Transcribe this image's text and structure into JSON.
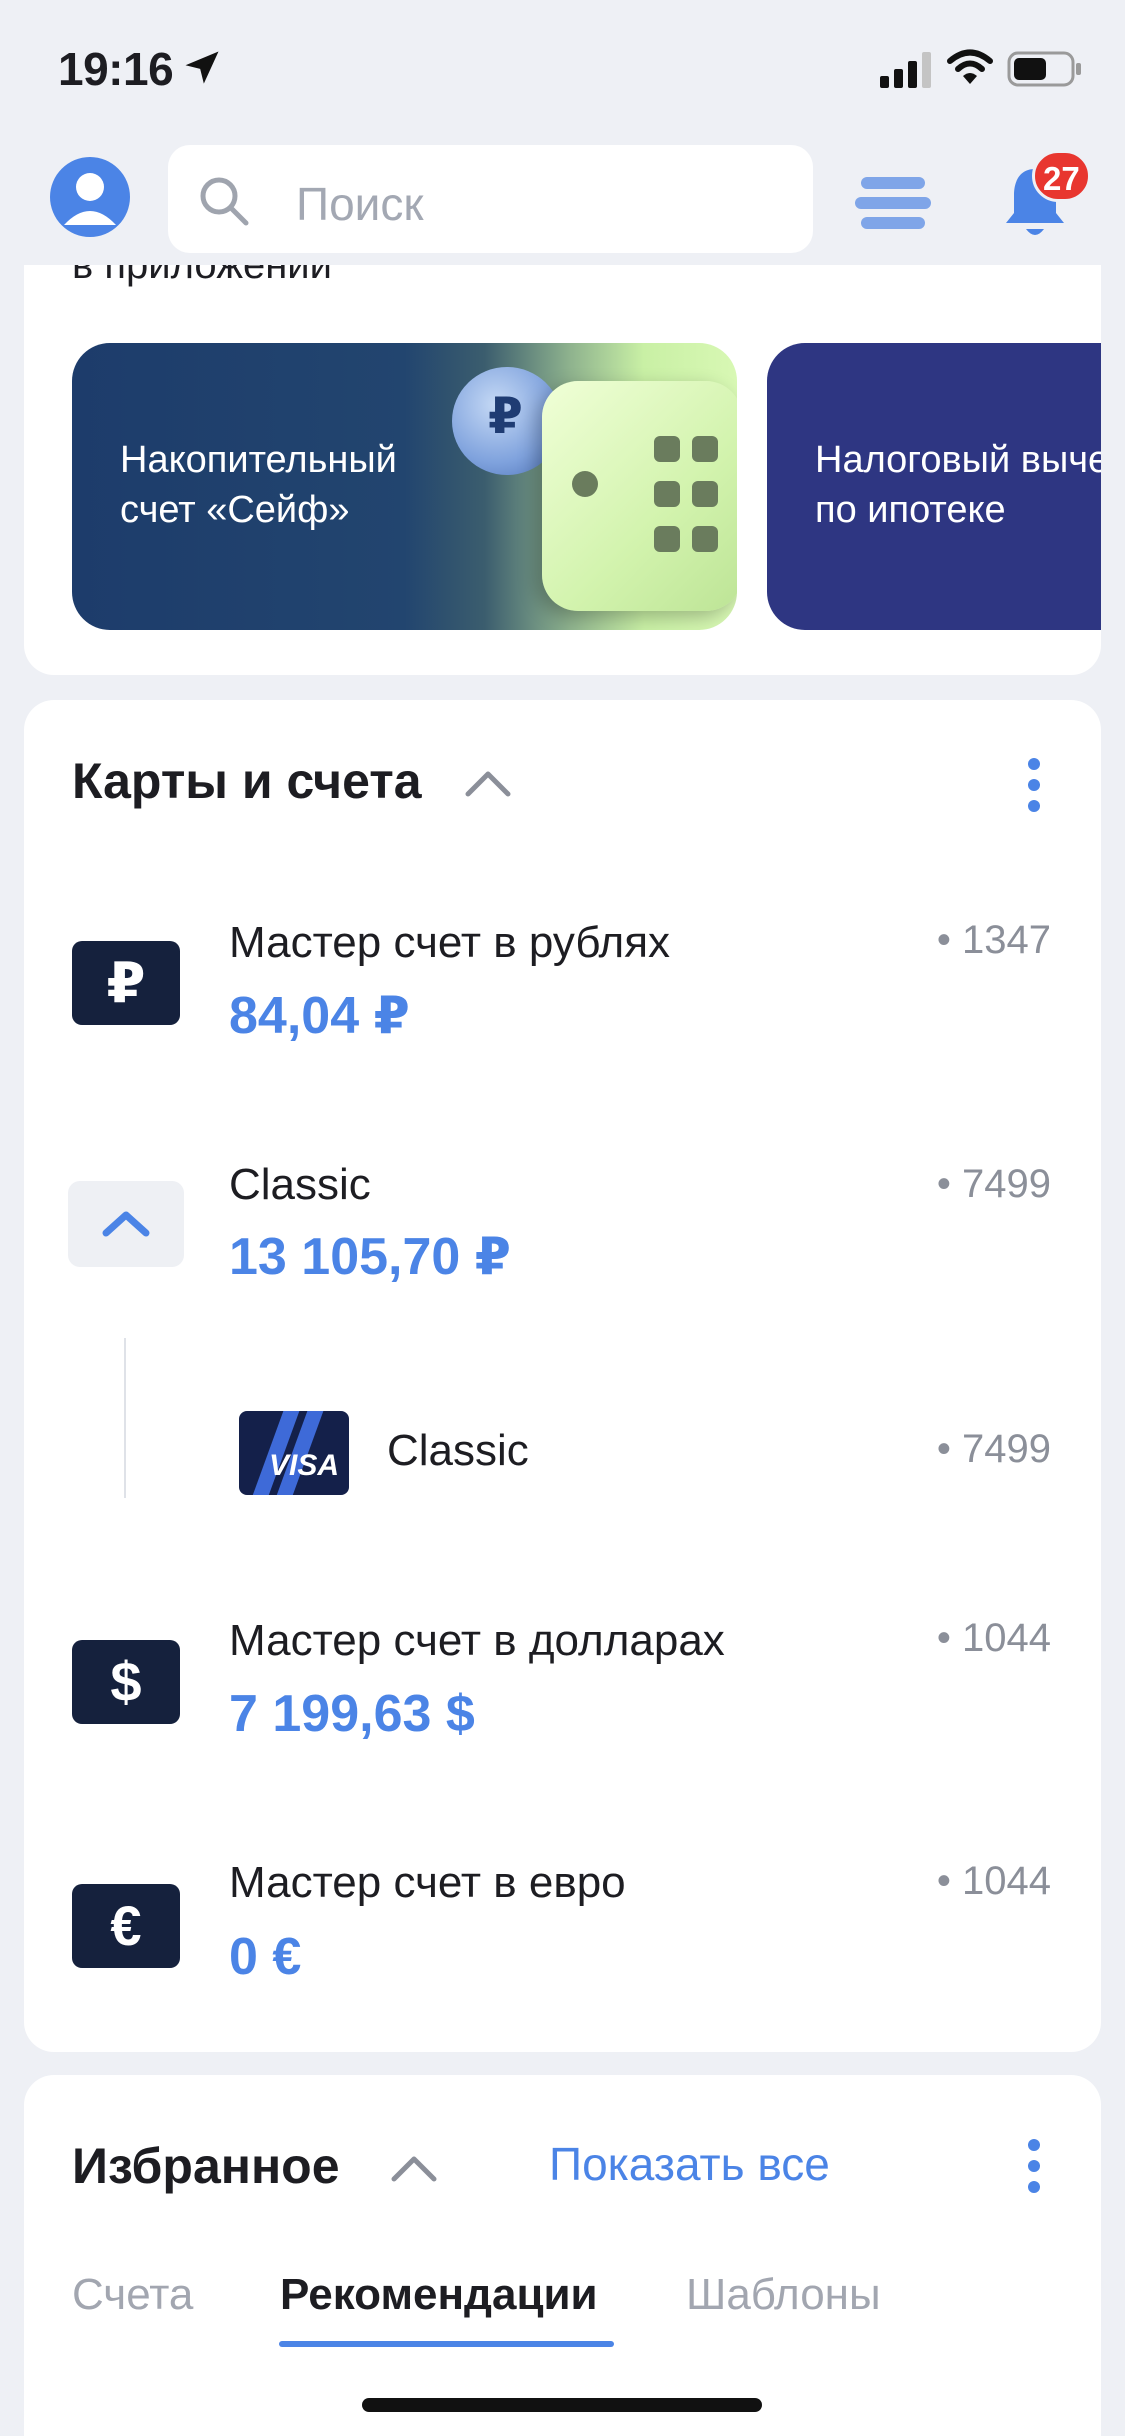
{
  "status_bar": {
    "time": "19:16",
    "icons": [
      "location-arrow-icon",
      "cellular-signal-icon",
      "wifi-icon",
      "battery-icon"
    ]
  },
  "header": {
    "search_placeholder": "Поиск",
    "notifications_count": "27"
  },
  "promo": {
    "heading": "в приложении",
    "stories": [
      {
        "text": "Накопительный\nсчет «Сейф»"
      },
      {
        "text": "Налоговый вычет\nпо ипотеке"
      }
    ],
    "coin_symbol": "₽"
  },
  "cards_section": {
    "title": "Карты и счета",
    "accounts": [
      {
        "icon_symbol": "₽",
        "name": "Мастер счет в рублях",
        "amount": "84,04 ₽",
        "number": "• 1347"
      },
      {
        "name": "Classic",
        "amount": "13 105,70 ₽",
        "number": "• 7499"
      },
      {
        "name": "Classic",
        "number": "• 7499",
        "card_brand": "VISA"
      },
      {
        "icon_symbol": "$",
        "name": "Мастер счет в долларах",
        "amount": "7 199,63 $",
        "number": "• 1044"
      },
      {
        "icon_symbol": "€",
        "name": "Мастер счет в евро",
        "amount": "0 €",
        "number": "• 1044"
      }
    ]
  },
  "favorites": {
    "title": "Избранное",
    "show_all": "Показать все",
    "tabs": [
      "Счета",
      "Рекомендации",
      "Шаблоны"
    ],
    "active_tab": "Рекомендации"
  },
  "colors": {
    "accent": "#4b84e6",
    "badge": "#e8362f",
    "background": "#eef0f5",
    "account_icon": "#15213d"
  }
}
